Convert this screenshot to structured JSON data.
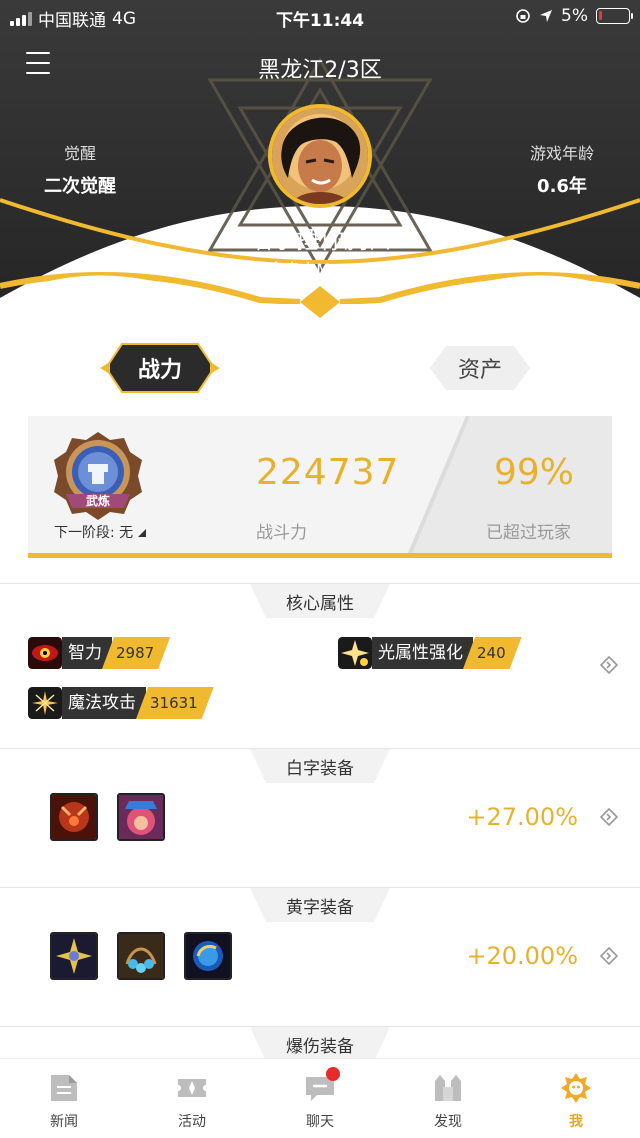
{
  "status_bar": {
    "carrier": "中国联通",
    "network": "4G",
    "time": "下午11:44",
    "battery": "5%"
  },
  "header": {
    "server": "黑龙江2/3区",
    "awaken_label": "觉醒",
    "awaken_value": "二次觉醒",
    "age_label": "游戏年龄",
    "age_value": "0.6年",
    "name": "喵拳捶你胸口",
    "info": "Lv.90丨念皇丨M a x ☆Family"
  },
  "tabs": [
    {
      "label": "战力",
      "active": true
    },
    {
      "label": "资产",
      "active": false
    }
  ],
  "power": {
    "badge_text": "武炼",
    "next_stage": "下一阶段: 无",
    "value": "224737",
    "value_label": "战斗力",
    "percent": "99%",
    "percent_label": "已超过玩家"
  },
  "core_attrs": {
    "title": "核心属性",
    "items": [
      {
        "name": "智力",
        "value": "2987",
        "icon": "eye-icon"
      },
      {
        "name": "光属性强化",
        "value": "240",
        "icon": "light-element-icon"
      },
      {
        "name": "魔法攻击",
        "value": "31631",
        "icon": "magic-attack-icon"
      }
    ]
  },
  "white_equip": {
    "title": "白字装备",
    "percent": "+27.00%",
    "items": [
      "red-demon-equip-icon",
      "pink-hair-equip-icon"
    ]
  },
  "yellow_equip": {
    "title": "黄字装备",
    "percent": "+20.00%",
    "items": [
      "star-flower-equip-icon",
      "blue-gem-equip-icon",
      "blue-orb-equip-icon"
    ]
  },
  "explode_equip": {
    "title": "爆伤装备"
  },
  "bottom_nav": [
    {
      "label": "新闻",
      "icon": "news-icon"
    },
    {
      "label": "活动",
      "icon": "activity-icon"
    },
    {
      "label": "聊天",
      "icon": "chat-icon",
      "badge": true
    },
    {
      "label": "发现",
      "icon": "discover-icon"
    },
    {
      "label": "我",
      "icon": "me-icon",
      "active": true
    }
  ],
  "colors": {
    "accent": "#f1b92f",
    "dark": "#2b2b2b",
    "value_text": "#e8b12d",
    "badge_red": "#e62b2b"
  }
}
